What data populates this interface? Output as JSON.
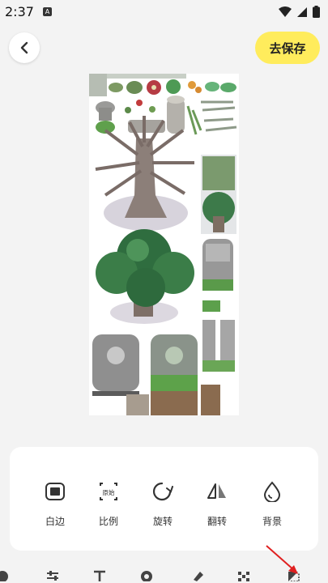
{
  "status_bar": {
    "time": "2:37",
    "app_badge": "A"
  },
  "header": {
    "save_label": "去保存"
  },
  "tools": [
    {
      "label": "白边",
      "icon": "border-icon"
    },
    {
      "label": "比例",
      "icon": "ratio-icon",
      "icon_text": "原始"
    },
    {
      "label": "旋转",
      "icon": "rotate-icon"
    },
    {
      "label": "翻转",
      "icon": "flip-icon"
    },
    {
      "label": "背景",
      "icon": "background-icon"
    }
  ],
  "colors": {
    "save_button": "#ffec5c",
    "panel": "#ffffff",
    "page_bg": "#f3f3f3",
    "annotation_arrow": "#e02020"
  }
}
